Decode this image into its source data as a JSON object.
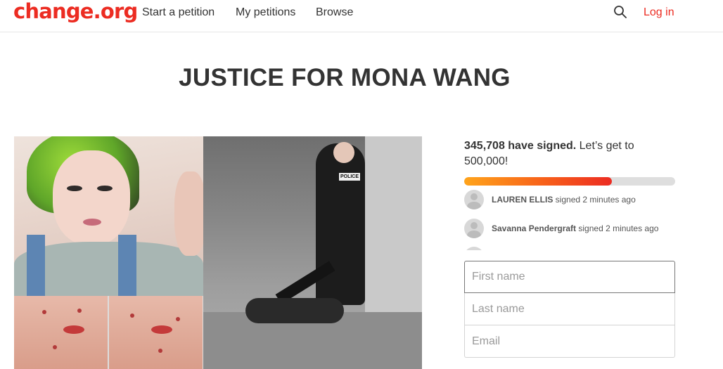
{
  "header": {
    "logo": "change.org",
    "nav": {
      "start_petition": "Start a petition",
      "my_petitions": "My petitions",
      "browse": "Browse"
    },
    "search_icon": "search-icon",
    "login": "Log in"
  },
  "petition": {
    "title": "JUSTICE FOR MONA WANG"
  },
  "signatures": {
    "count_text": "345,708 have signed.",
    "goal_text": " Let’s get to 500,000!",
    "progress_fraction": 0.7
  },
  "recent_signers": [
    {
      "name": "LAUREN ELLIS",
      "action": " signed 2 minutes ago"
    },
    {
      "name": "Savanna Pendergraft",
      "action": " signed 2 minutes ago"
    }
  ],
  "form": {
    "first_name_placeholder": "First name",
    "last_name_placeholder": "Last name",
    "email_placeholder": "Email"
  },
  "colors": {
    "brand": "#ec2c22",
    "progress_start": "#ffa41b",
    "progress_end": "#ec2c22"
  }
}
